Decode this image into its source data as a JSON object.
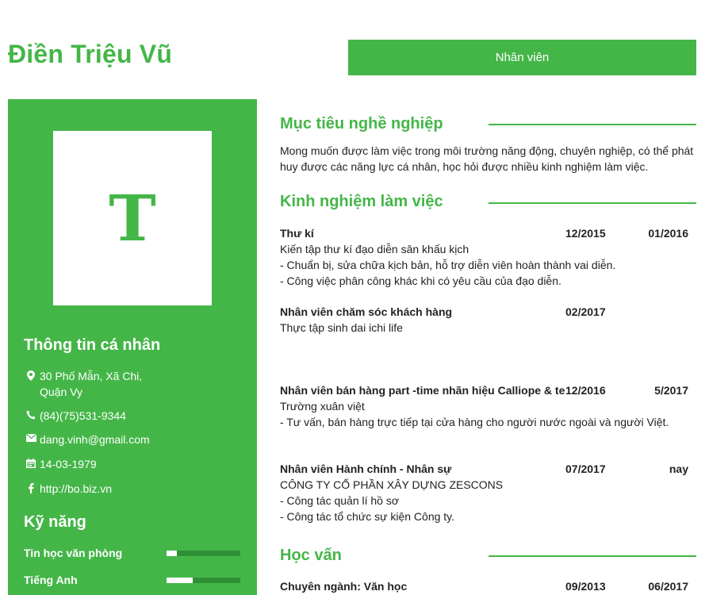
{
  "header": {
    "name": "Điền Triệu Vũ",
    "position": "Nhân viên"
  },
  "avatar": {
    "initial": "T"
  },
  "personal_info": {
    "heading": "Thông tin cá nhân",
    "address_line1": "30 Phố Mẫn, Xã Chi,",
    "address_line2": "Quận Vy",
    "phone": "(84)(75)531-9344",
    "email": "dang.vinh@gmail.com",
    "birthday": "14-03-1979",
    "website": "http://bo.biz.vn"
  },
  "skills": {
    "heading": "Kỹ năng",
    "items": [
      {
        "label": "Tin học văn phòng",
        "level": 0.14
      },
      {
        "label": "Tiếng Anh",
        "level": 0.36
      }
    ]
  },
  "objective": {
    "heading": "Mục tiêu nghề nghiệp",
    "text": "Mong muốn được làm việc trong môi trường năng động, chuyên nghiệp, có thể phát huy được các năng lực cá nhân, học hỏi được nhiều kinh nghiệm làm việc."
  },
  "experience": {
    "heading": "Kinh nghiệm làm việc",
    "jobs": [
      {
        "title": "Thư kí",
        "start": "12/2015",
        "end": "01/2016",
        "lines": [
          "Kiến tập thư kí đạo diễn sân khấu kịch",
          "- Chuẩn bị, sửa chữa kịch bản, hỗ trợ diễn viên hoàn thành vai diễn.",
          "- Công việc phân công khác khi có yêu cầu của đạo diễn."
        ]
      },
      {
        "title": "Nhân viên chăm sóc khách hàng",
        "start": "02/2017",
        "end": "",
        "lines": [
          "Thực tập sinh dai ichi life"
        ]
      },
      {
        "title": "Nhân viên bán hàng part -time nhãn hiệu Calliope & teddy",
        "start": "12/2016",
        "end": "5/2017",
        "lines": [
          "Trường xuân việt",
          "- Tư vấn, bán hàng trực tiếp tại cửa hàng cho người nước ngoài và người Việt."
        ]
      },
      {
        "title": "Nhân viên Hành chính - Nhân sự",
        "start": "07/2017",
        "end": "nay",
        "lines": [
          "CÔNG TY CỔ PHẦN XÂY DỰNG ZESCONS",
          "- Công tác quản lí hồ sơ",
          "- Công tác tổ chức sự kiện Công ty."
        ]
      }
    ]
  },
  "education": {
    "heading": "Học vấn",
    "items": [
      {
        "title": "Chuyên ngành: Văn học",
        "start": "09/2013",
        "end": "06/2017"
      }
    ]
  },
  "colors": {
    "accent": "#44b648",
    "text": "#222222"
  },
  "icons": [
    "map-marker-icon",
    "phone-icon",
    "envelope-icon",
    "calendar-icon",
    "facebook-icon"
  ]
}
